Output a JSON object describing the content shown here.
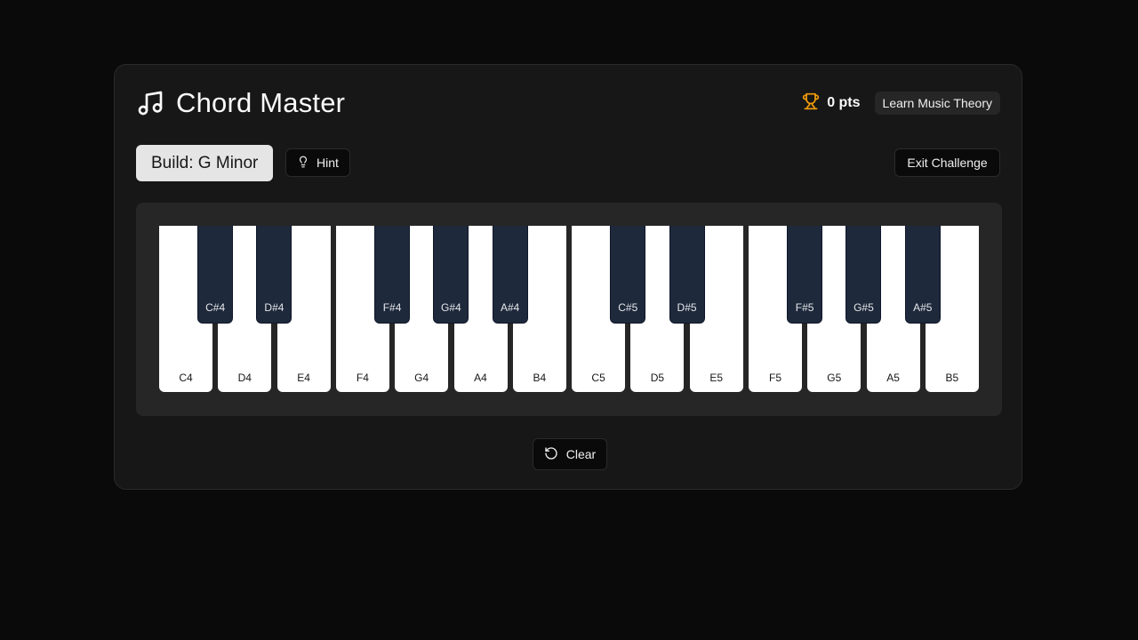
{
  "header": {
    "title": "Chord Master",
    "title_icon": "music-note-icon",
    "score_icon": "trophy-icon",
    "score_text": "0 pts",
    "learn_label": "Learn Music Theory"
  },
  "toolbar": {
    "build_label": "Build: G Minor",
    "hint_label": "Hint",
    "hint_icon": "lightbulb-icon",
    "exit_label": "Exit Challenge"
  },
  "keyboard": {
    "white_keys": [
      "C4",
      "D4",
      "E4",
      "F4",
      "G4",
      "A4",
      "B4",
      "C5",
      "D5",
      "E5",
      "F5",
      "G5",
      "A5",
      "B5"
    ],
    "black_keys": [
      "C#4",
      "D#4",
      "F#4",
      "G#4",
      "A#4",
      "C#5",
      "D#5",
      "F#5",
      "G#5",
      "A#5"
    ]
  },
  "actions": {
    "clear_label": "Clear",
    "clear_icon": "rotate-ccw-icon"
  },
  "colors": {
    "accent_gold": "#f59e0b",
    "black_key": "#1e293b",
    "build_badge_bg": "#e5e5e5"
  }
}
